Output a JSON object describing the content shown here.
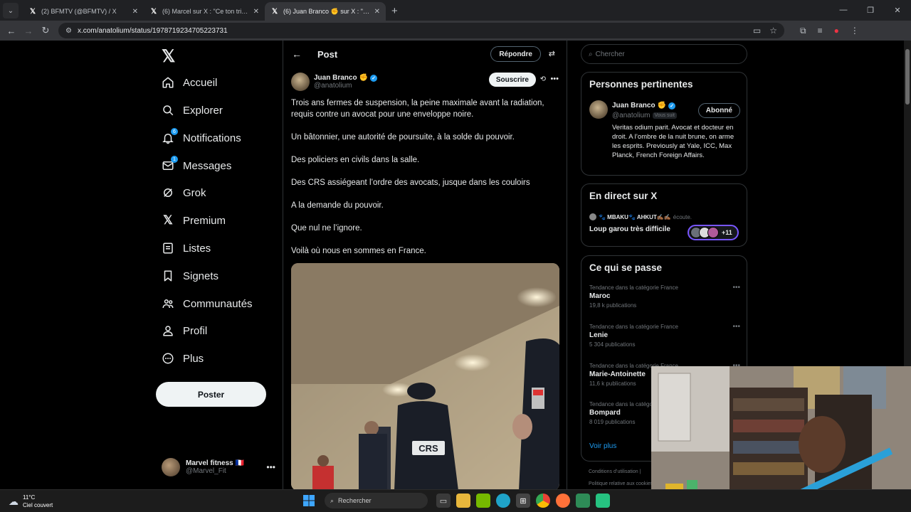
{
  "browser": {
    "tabs": [
      {
        "title": "(2) BFMTV (@BFMTV) / X",
        "active": false
      },
      {
        "title": "(6) Marcel sur X : \"Ce ton triomphal",
        "active": false
      },
      {
        "title": "(6) Juan Branco ✊ sur X : \"Trois ans",
        "active": true
      }
    ],
    "url": "x.com/anatolium/status/1978719234705223731"
  },
  "nav": {
    "items": [
      {
        "label": "Accueil",
        "icon": "home-icon",
        "badge": ""
      },
      {
        "label": "Explorer",
        "icon": "search-icon",
        "badge": ""
      },
      {
        "label": "Notifications",
        "icon": "bell-icon",
        "badge": "6"
      },
      {
        "label": "Messages",
        "icon": "envelope-icon",
        "badge": "1"
      },
      {
        "label": "Grok",
        "icon": "grok-icon",
        "badge": ""
      },
      {
        "label": "Premium",
        "icon": "x-icon",
        "badge": ""
      },
      {
        "label": "Listes",
        "icon": "list-icon",
        "badge": ""
      },
      {
        "label": "Signets",
        "icon": "bookmark-icon",
        "badge": ""
      },
      {
        "label": "Communautés",
        "icon": "people-icon",
        "badge": ""
      },
      {
        "label": "Profil",
        "icon": "person-icon",
        "badge": ""
      },
      {
        "label": "Plus",
        "icon": "more-circle-icon",
        "badge": ""
      }
    ],
    "post_button": "Poster",
    "account": {
      "name": "Marvel fitness 🇫🇷",
      "handle": "@Marvel_Fit"
    }
  },
  "main": {
    "header_title": "Post",
    "reply_button": "Répondre",
    "author": {
      "name": "Juan Branco",
      "handle": "@anatolium"
    },
    "subscribe_button": "Souscrire",
    "paragraphs": [
      "Trois ans fermes de suspension, la peine maximale avant la radiation, requis contre un avocat pour une enveloppe noire.",
      "Un bâtonnier, une autorité de poursuite, à la solde du pouvoir.",
      "Des policiers en civils dans la salle.",
      "Des CRS assiégeant l’ordre des avocats, jusque dans les couloirs",
      "A la demande du pouvoir.",
      "Que nul ne l’ignore.",
      "Voilà où nous en sommes en France."
    ],
    "media_label": "CRS"
  },
  "right": {
    "search_placeholder": "Chercher",
    "relevant": {
      "title": "Personnes pertinentes",
      "name": "Juan Branco",
      "handle": "@anatolium",
      "follows_you": "Vous suit",
      "follow_button": "Abonné",
      "bio": "Veritas odium parit. Avocat et docteur en droit. A l’ombre de la nuit brune, on arme les esprits. Previously at Yale, ICC, Max Planck, French Foreign Affairs."
    },
    "live": {
      "title": "En direct sur X",
      "hosts": "🐾 MBAKU🐾 AHKUT✍🏾✍🏾",
      "listening": "écoute.",
      "space_title": "Loup garou très difficile",
      "count": "+11"
    },
    "trends": {
      "title": "Ce qui se passe",
      "items": [
        {
          "category": "Tendance dans la catégorie France",
          "name": "Maroc",
          "count": "19,8 k publications"
        },
        {
          "category": "Tendance dans la catégorie France",
          "name": "Lenie",
          "count": "5 304 publications"
        },
        {
          "category": "Tendance dans la catégorie France",
          "name": "Marie-Antoinette",
          "count": "11,6 k publications"
        },
        {
          "category": "Tendance dans la catégorie France",
          "name": "Bompard",
          "count": "8 019 publications"
        }
      ],
      "show_more": "Voir plus"
    },
    "footer": [
      "Conditions d’utilisation |",
      "Politique relative aux cookies"
    ]
  },
  "taskbar": {
    "temperature": "11°C",
    "weather": "Ciel couvert",
    "search_placeholder": "Rechercher"
  },
  "colors": {
    "accent": "#1d9bf0",
    "background": "#000000",
    "border": "#2f3336",
    "muted": "#71767b"
  }
}
